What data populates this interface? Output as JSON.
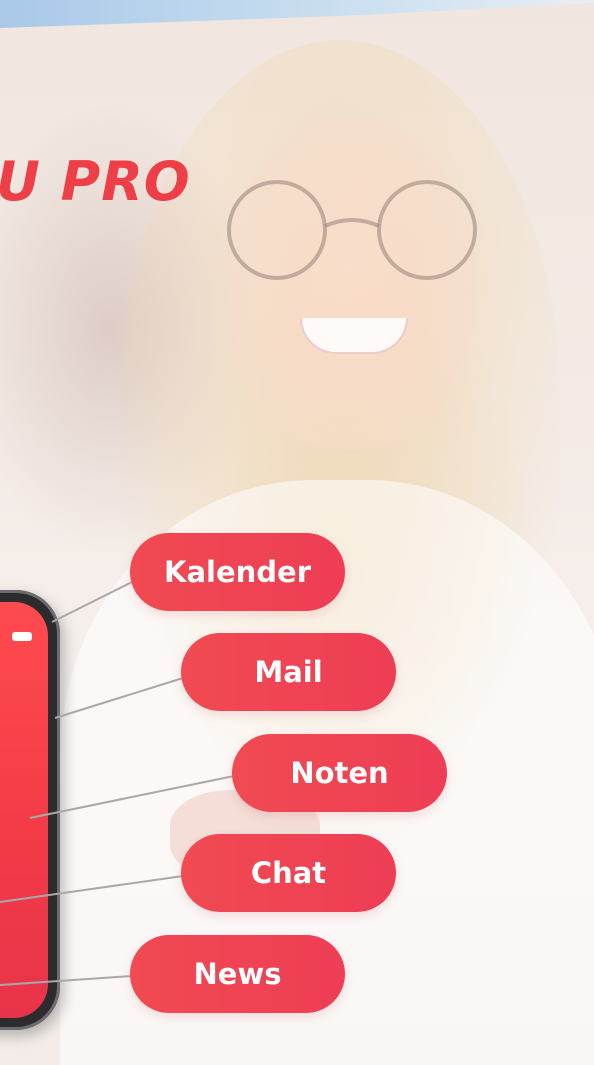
{
  "headline": {
    "text": "U PRO",
    "color": "#ee3e47"
  },
  "features": [
    {
      "label": "Kalender"
    },
    {
      "label": "Mail"
    },
    {
      "label": "Noten"
    },
    {
      "label": "Chat"
    },
    {
      "label": "News"
    }
  ],
  "colors": {
    "accent": "#ee3e47",
    "pill_start": "#f14a52",
    "pill_end": "#ee3d55",
    "phone_screen": "#f23a47",
    "top_strip": "#a9c9e8"
  }
}
